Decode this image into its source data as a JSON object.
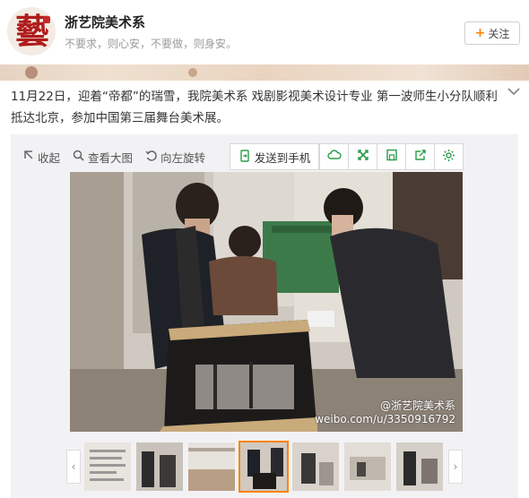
{
  "account": {
    "avatar_text": "藝",
    "name": "浙艺院美术系",
    "slogan": "不要求，则心安，不要做，则身安。",
    "follow_label": "关注"
  },
  "post": {
    "text": "11月22日，迎着“帝都”的瑞雪，我院美术系 戏剧影视美术设计专业 第一波师生小分队顺利抵达北京，参加中国第三届舞台美术展。"
  },
  "toolbar": {
    "collapse_label": "收起",
    "view_large_label": "查看大图",
    "rotate_left_label": "向左旋转",
    "send_to_phone_label": "发送到手机"
  },
  "photo": {
    "watermark_handle": "@浙艺院美术系",
    "watermark_url": "weibo.com/u/3350916792"
  },
  "colors": {
    "accent": "#ff8200",
    "toolbar_icon": "#2a9d4a",
    "seal_red": "#b01c1c"
  },
  "icons": {
    "follow": "plus-icon",
    "collapse": "collapse-icon",
    "view_large": "magnifier-icon",
    "rotate": "rotate-left-icon",
    "send": "send-to-phone-icon",
    "cloud": "cloud-icon",
    "expand": "expand-icon",
    "save": "save-icon",
    "share": "share-icon",
    "settings": "gear-icon",
    "menu": "chevron-down-icon"
  }
}
